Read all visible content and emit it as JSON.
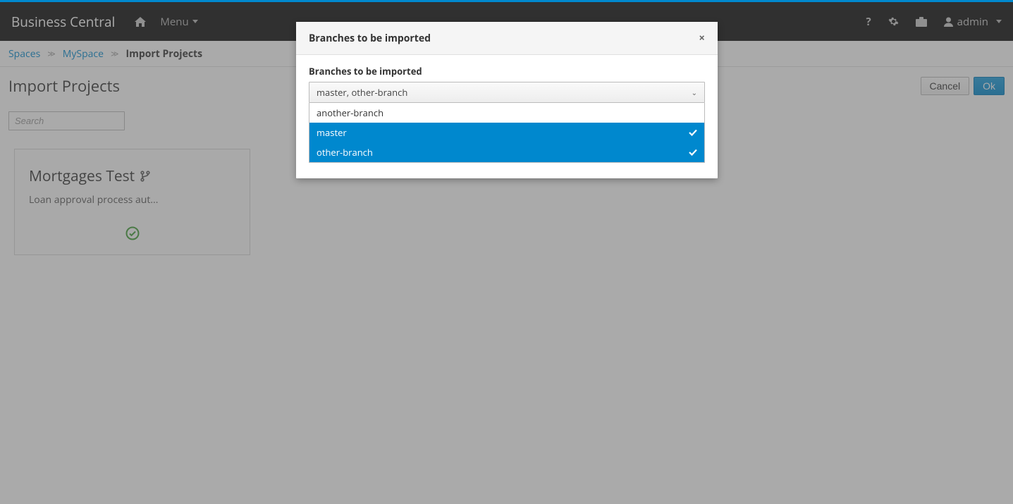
{
  "topbar": {
    "brand": "Business Central",
    "menu_label": "Menu",
    "user_label": "admin"
  },
  "breadcrumbs": {
    "items": [
      "Spaces",
      "MySpace",
      "Import Projects"
    ]
  },
  "page": {
    "title": "Import Projects",
    "cancel_label": "Cancel",
    "ok_label": "Ok",
    "search_placeholder": "Search"
  },
  "card": {
    "title": "Mortgages Test",
    "desc": "Loan approval process aut..."
  },
  "modal": {
    "title": "Branches to be imported",
    "field_label": "Branches to be imported",
    "selected_text": "master, other-branch",
    "options": [
      {
        "label": "another-branch",
        "selected": false
      },
      {
        "label": "master",
        "selected": true
      },
      {
        "label": "other-branch",
        "selected": true
      }
    ]
  }
}
